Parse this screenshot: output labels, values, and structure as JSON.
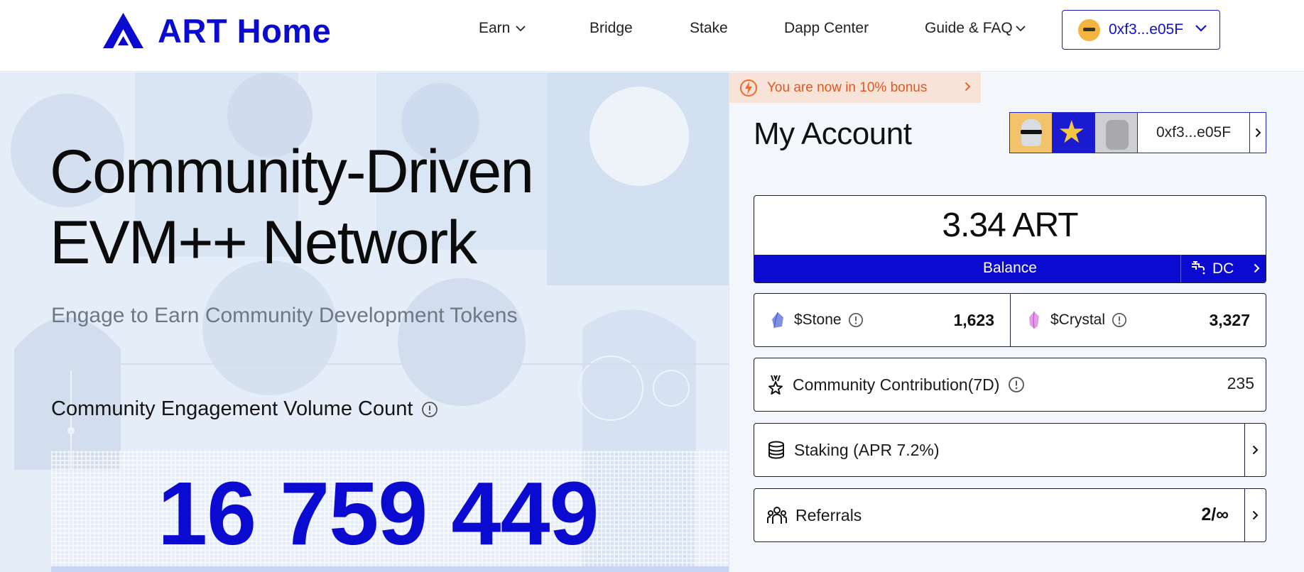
{
  "header": {
    "logo_text": "ART Home",
    "nav": [
      {
        "label": "Earn",
        "has_dropdown": true
      },
      {
        "label": "Bridge"
      },
      {
        "label": "Stake"
      },
      {
        "label": "Dapp Center"
      },
      {
        "label": "Guide & FAQ",
        "has_dropdown": true
      }
    ],
    "wallet_address": "0xf3...e05F",
    "brand_color": "#0a0ad0"
  },
  "hero": {
    "title_line1": "Community-Driven",
    "title_line2": "EVM++ Network",
    "subtitle": "Engage to Earn Community Development Tokens",
    "engagement_label": "Community Engagement Volume Count",
    "engagement_count": "16 759 449"
  },
  "account": {
    "bonus_text": "You are now in 10% bonus",
    "title": "My Account",
    "address": "0xf3...e05F",
    "balance": {
      "value": "3.34 ART",
      "label": "Balance",
      "dc_label": "DC"
    },
    "tokens": [
      {
        "name": "$Stone",
        "value": "1,623",
        "icon": "stone-icon"
      },
      {
        "name": "$Crystal",
        "value": "3,327",
        "icon": "crystal-icon"
      }
    ],
    "contribution": {
      "label": "Community Contribution(7D)",
      "value": "235"
    },
    "staking": {
      "label": "Staking (APR 7.2%)"
    },
    "referrals": {
      "label": "Referrals",
      "value": "2/∞"
    }
  }
}
